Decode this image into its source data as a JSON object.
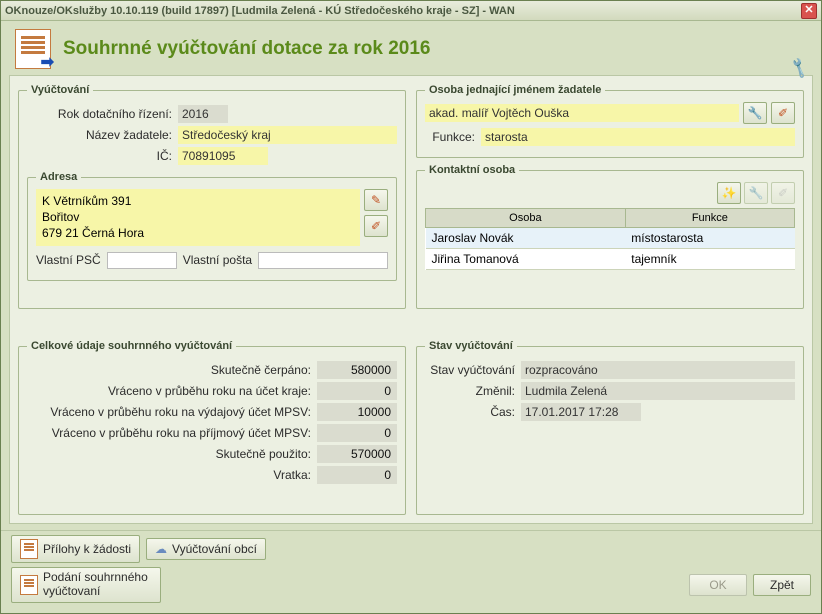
{
  "window_title": "OKnouze/OKslužby 10.10.119 (build 17897)  [Ludmila Zelená - KÚ Středočeského kraje - SZ] - WAN",
  "page_title": "Souhrnné vyúčtování dotace za rok 2016",
  "vyuctovani": {
    "legend": "Vyúčtování",
    "rok_label": "Rok dotačního řízení:",
    "rok": "2016",
    "nazev_label": "Název žadatele:",
    "nazev": "Středočeský kraj",
    "ic_label": "IČ:",
    "ic": "70891095"
  },
  "adresa": {
    "legend": "Adresa",
    "lines": "K Větrníkům 391\nBořitov\n679 21 Černá Hora",
    "psc_label": "Vlastní PSČ",
    "psc": "",
    "posta_label": "Vlastní pošta",
    "posta": ""
  },
  "osoba": {
    "legend": "Osoba jednající jménem žadatele",
    "name": "akad. malíř Vojtěch Ouška",
    "funkce_label": "Funkce:",
    "funkce": "starosta"
  },
  "kontakt": {
    "legend": "Kontaktní osoba",
    "col_osoba": "Osoba",
    "col_funkce": "Funkce",
    "rows": [
      {
        "o": "Jaroslav Novák",
        "f": "místostarosta"
      },
      {
        "o": "Jiřina Tomanová",
        "f": "tajemník"
      }
    ]
  },
  "celkove": {
    "legend": "Celkové údaje souhrnného vyúčtování",
    "items": [
      {
        "l": "Skutečně čerpáno:",
        "v": "580000"
      },
      {
        "l": "Vráceno v průběhu roku na účet kraje:",
        "v": "0"
      },
      {
        "l": "Vráceno v průběhu roku na výdajový účet MPSV:",
        "v": "10000"
      },
      {
        "l": "Vráceno v průběhu roku na příjmový účet MPSV:",
        "v": "0"
      },
      {
        "l": "Skutečně použito:",
        "v": "570000"
      },
      {
        "l": "Vratka:",
        "v": "0"
      }
    ]
  },
  "stav": {
    "legend": "Stav vyúčtování",
    "stav_label": "Stav vyúčtování",
    "stav": "rozpracováno",
    "zmenil_label": "Změnil:",
    "zmenil": "Ludmila Zelená",
    "cas_label": "Čas:",
    "cas": "17.01.2017 17:28"
  },
  "footer": {
    "prilohy": "Přílohy k žádosti",
    "obci": "Vyúčtování obcí",
    "podani": "Podání souhrnného vyúčtovaní",
    "ok": "OK",
    "zpet": "Zpět"
  }
}
